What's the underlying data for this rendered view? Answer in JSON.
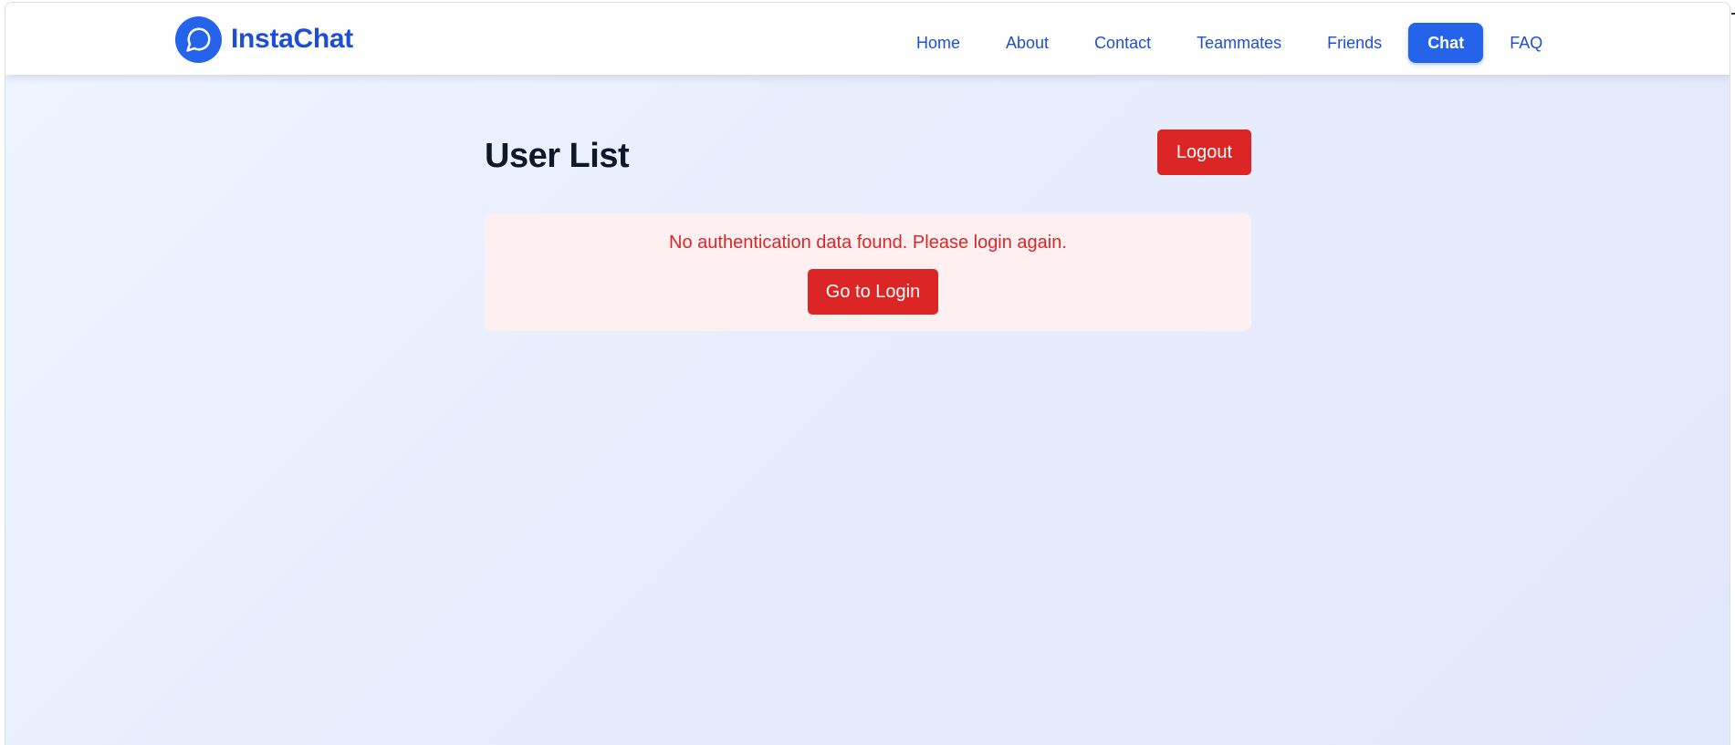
{
  "brand": {
    "name": "InstaChat",
    "logo_icon": "chat-bubble-icon",
    "color": "#2563eb"
  },
  "nav": {
    "items": [
      {
        "label": "Home",
        "active": false
      },
      {
        "label": "About",
        "active": false
      },
      {
        "label": "Contact",
        "active": false
      },
      {
        "label": "Teammates",
        "active": false
      },
      {
        "label": "Friends",
        "active": false
      },
      {
        "label": "Chat",
        "active": true
      },
      {
        "label": "FAQ",
        "active": false
      }
    ]
  },
  "main": {
    "title": "User List",
    "logout_label": "Logout",
    "error": {
      "message": "No authentication data found. Please login again.",
      "button_label": "Go to Login"
    }
  },
  "colors": {
    "accent": "#2563eb",
    "danger": "#dc2626",
    "error_bg": "#fef0f1",
    "title": "#0f172a"
  }
}
